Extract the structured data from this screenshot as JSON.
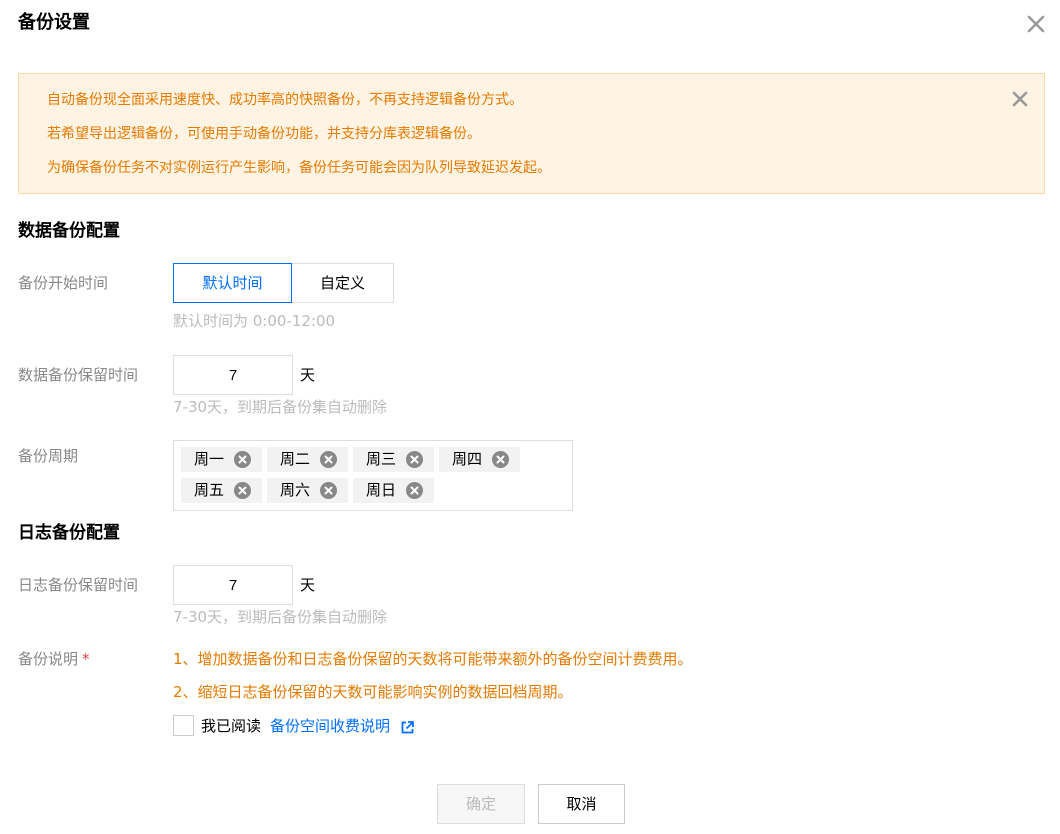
{
  "dialog": {
    "title": "备份设置"
  },
  "notice": {
    "lines": [
      "自动备份现全面采用速度快、成功率高的快照备份，不再支持逻辑备份方式。",
      "若希望导出逻辑备份，可使用手动备份功能，并支持分库表逻辑备份。",
      "为确保备份任务不对实例运行产生影响，备份任务可能会因为队列导致延迟发起。"
    ]
  },
  "data_backup": {
    "section_title": "数据备份配置",
    "start_time": {
      "label": "备份开始时间",
      "options": [
        "默认时间",
        "自定义"
      ],
      "selected": "默认时间",
      "hint": "默认时间为 0:00-12:00"
    },
    "retention": {
      "label": "数据备份保留时间",
      "value": "7",
      "unit": "天",
      "hint": "7-30天，到期后备份集自动删除"
    },
    "period": {
      "label": "备份周期",
      "tags": [
        "周一",
        "周二",
        "周三",
        "周四",
        "周五",
        "周六",
        "周日"
      ]
    }
  },
  "log_backup": {
    "section_title": "日志备份配置",
    "retention": {
      "label": "日志备份保留时间",
      "value": "7",
      "unit": "天",
      "hint": "7-30天，到期后备份集自动删除"
    }
  },
  "notes": {
    "label": "备份说明",
    "required_mark": "*",
    "lines": [
      "1、增加数据备份和日志备份保留的天数将可能带来额外的备份空间计费费用。",
      "2、缩短日志备份保留的天数可能影响实例的数据回档周期。"
    ],
    "agree_prefix": "我已阅读",
    "agree_link": "备份空间收费说明",
    "agree_checked": false
  },
  "footer": {
    "confirm_label": "确定",
    "cancel_label": "取消",
    "confirm_disabled": true
  },
  "colors": {
    "accent": "#006eff",
    "warning_text": "#e57a00",
    "notice_bg": "#fff4e3",
    "notice_border": "#ffd8a6",
    "required": "#e54545"
  },
  "icons": {
    "dialog_close": "close-icon",
    "notice_close": "close-icon",
    "tag_remove": "remove-circle-icon",
    "link_external": "external-link-icon"
  }
}
